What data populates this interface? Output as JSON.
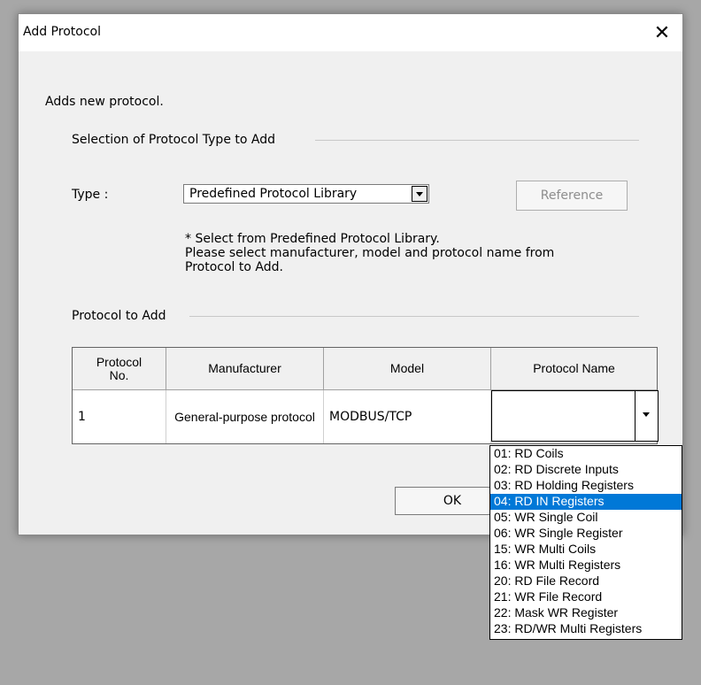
{
  "dialog": {
    "title": "Add Protocol",
    "close_symbol": "✕",
    "description": "Adds new protocol.",
    "group1_title": "Selection of Protocol Type to Add",
    "type_label": "Type :",
    "type_value": "Predefined Protocol Library",
    "reference_button": "Reference",
    "note_lines": [
      "* Select from Predefined Protocol Library.",
      "Please select manufacturer, model and protocol name from",
      "Protocol to Add."
    ],
    "group2_title": "Protocol to Add",
    "ok_button": "OK"
  },
  "table": {
    "headers": [
      "Protocol No.",
      "Manufacturer",
      "Model",
      "Protocol Name"
    ],
    "row": {
      "no": "1",
      "manufacturer": "General-purpose protocol",
      "model": "MODBUS/TCP",
      "protocol_name": ""
    }
  },
  "dropdown": {
    "selected_index": 3,
    "options": [
      "01: RD Coils",
      "02: RD Discrete Inputs",
      "03: RD Holding Registers",
      "04: RD IN Registers",
      "05: WR Single Coil",
      "06: WR Single Register",
      "15: WR Multi Coils",
      "16: WR Multi Registers",
      "20: RD File Record",
      "21: WR File Record",
      "22: Mask WR Register",
      "23: RD/WR Multi Registers"
    ]
  },
  "colors": {
    "selection": "#0078d7",
    "background": "#a7a7a7",
    "dialog_bg": "#f0f0f0"
  }
}
